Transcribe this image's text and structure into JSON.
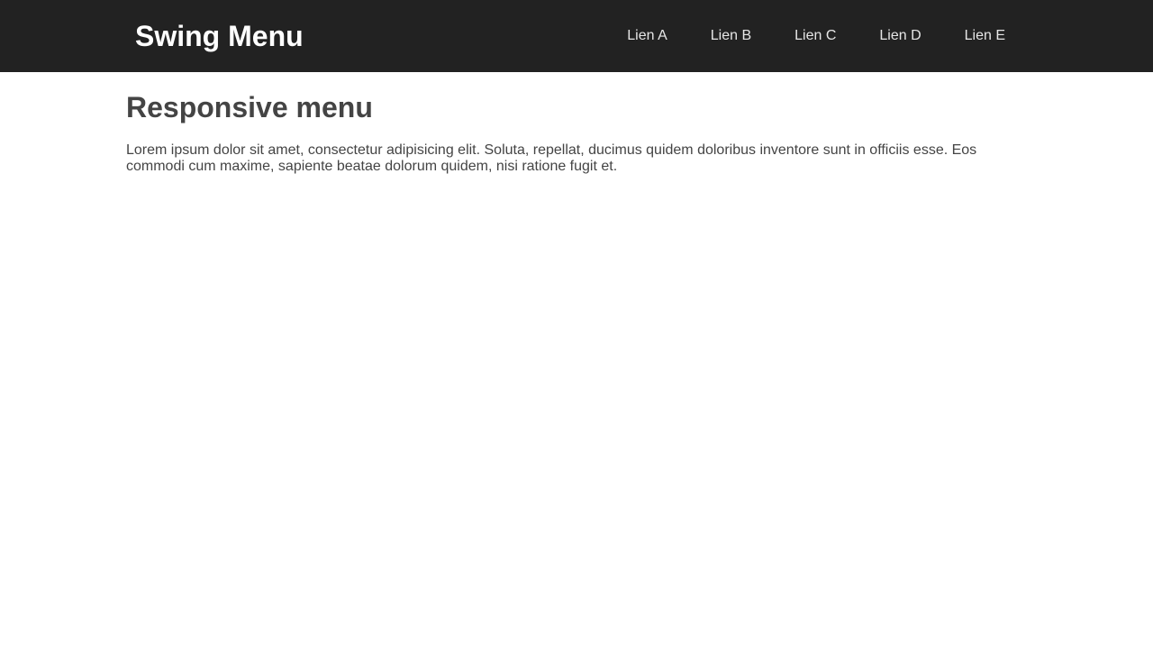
{
  "header": {
    "brand": "Swing Menu",
    "nav": [
      {
        "label": "Lien A"
      },
      {
        "label": "Lien B"
      },
      {
        "label": "Lien C"
      },
      {
        "label": "Lien D"
      },
      {
        "label": "Lien E"
      }
    ]
  },
  "main": {
    "title": "Responsive menu",
    "paragraph": "Lorem ipsum dolor sit amet, consectetur adipisicing elit. Soluta, repellat, ducimus quidem doloribus inventore sunt in officiis esse. Eos commodi cum maxime, sapiente beatae dolorum quidem, nisi ratione fugit et."
  },
  "colors": {
    "header_bg": "#222222",
    "brand_text": "#ffffff",
    "nav_text": "#e6e6e6",
    "body_text": "#444444",
    "page_bg": "#ffffff"
  }
}
